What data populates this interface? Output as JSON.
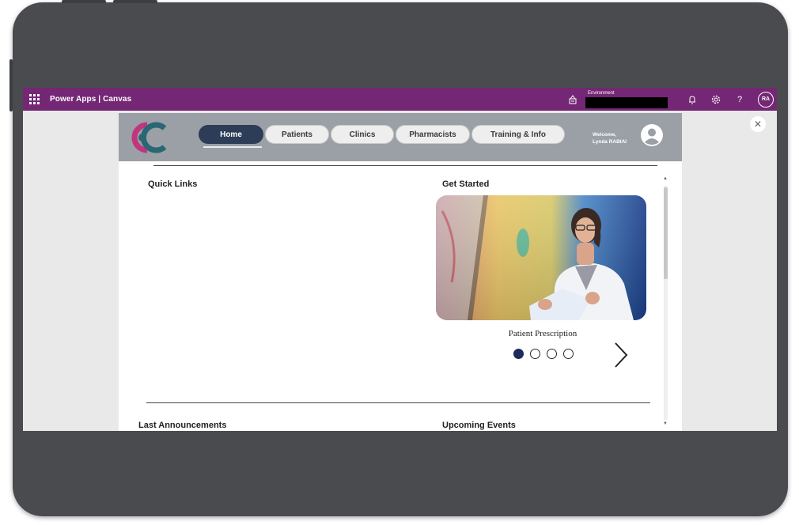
{
  "power_apps_bar": {
    "title": "Power Apps | Canvas",
    "environment_label": "Environment",
    "user_initials": "RA",
    "icons": [
      "waffle-icon",
      "environment-icon",
      "bell-icon",
      "gear-icon",
      "help-icon"
    ],
    "color": "#742774"
  },
  "app": {
    "nav": [
      {
        "label": "Home",
        "active": true
      },
      {
        "label": "Patients",
        "active": false
      },
      {
        "label": "Clinics",
        "active": false
      },
      {
        "label": "Pharmacists",
        "active": false
      },
      {
        "label": "Training & Info",
        "active": false
      }
    ],
    "welcome_line1": "Welcome,",
    "welcome_line2": "Lynda RABIAI",
    "sections": {
      "quick_links": "Quick Links",
      "get_started": "Get Started",
      "last_announcements": "Last Announcements",
      "upcoming_events": "Upcoming Events"
    },
    "carousel": {
      "caption": "Patient Prescription",
      "total_slides": 4,
      "active_slide": 1
    },
    "colors": {
      "header_bg": "#9aa0a5",
      "nav_active": "#2e3d57",
      "logo_magenta": "#c2357e",
      "logo_teal": "#2a6673",
      "dot_active": "#1c2b5a"
    }
  }
}
